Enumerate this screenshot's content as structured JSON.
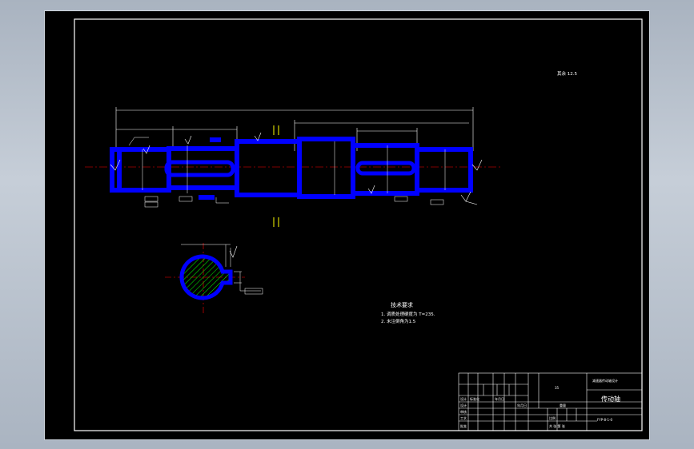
{
  "drawing": {
    "roughness": "其余 12.5",
    "technical_requirements": {
      "title": "技术要求",
      "line1": "1. 调质处理硬度为 T=235.",
      "line2": "2. 未注倒角为1.5"
    }
  },
  "title_block": {
    "part_name": "传动轴",
    "drawing_number": "FYP-8-1-0",
    "material": "35",
    "school": "减速器传动轴设计",
    "signature_row": [
      "设计",
      "标准化",
      "年月日"
    ],
    "scale": "比例",
    "sheet": "共 张 第 张",
    "designer_label": "设计",
    "reviewer_label": "审核",
    "process_label": "工艺",
    "approve_label": "批准",
    "date_label": "年月日",
    "weight_label": "重量"
  },
  "colors": {
    "part": "#0000ff",
    "line": "#ffffff",
    "center": "#ff0000",
    "hatch": "#00ff00",
    "accent": "#ffff00"
  }
}
